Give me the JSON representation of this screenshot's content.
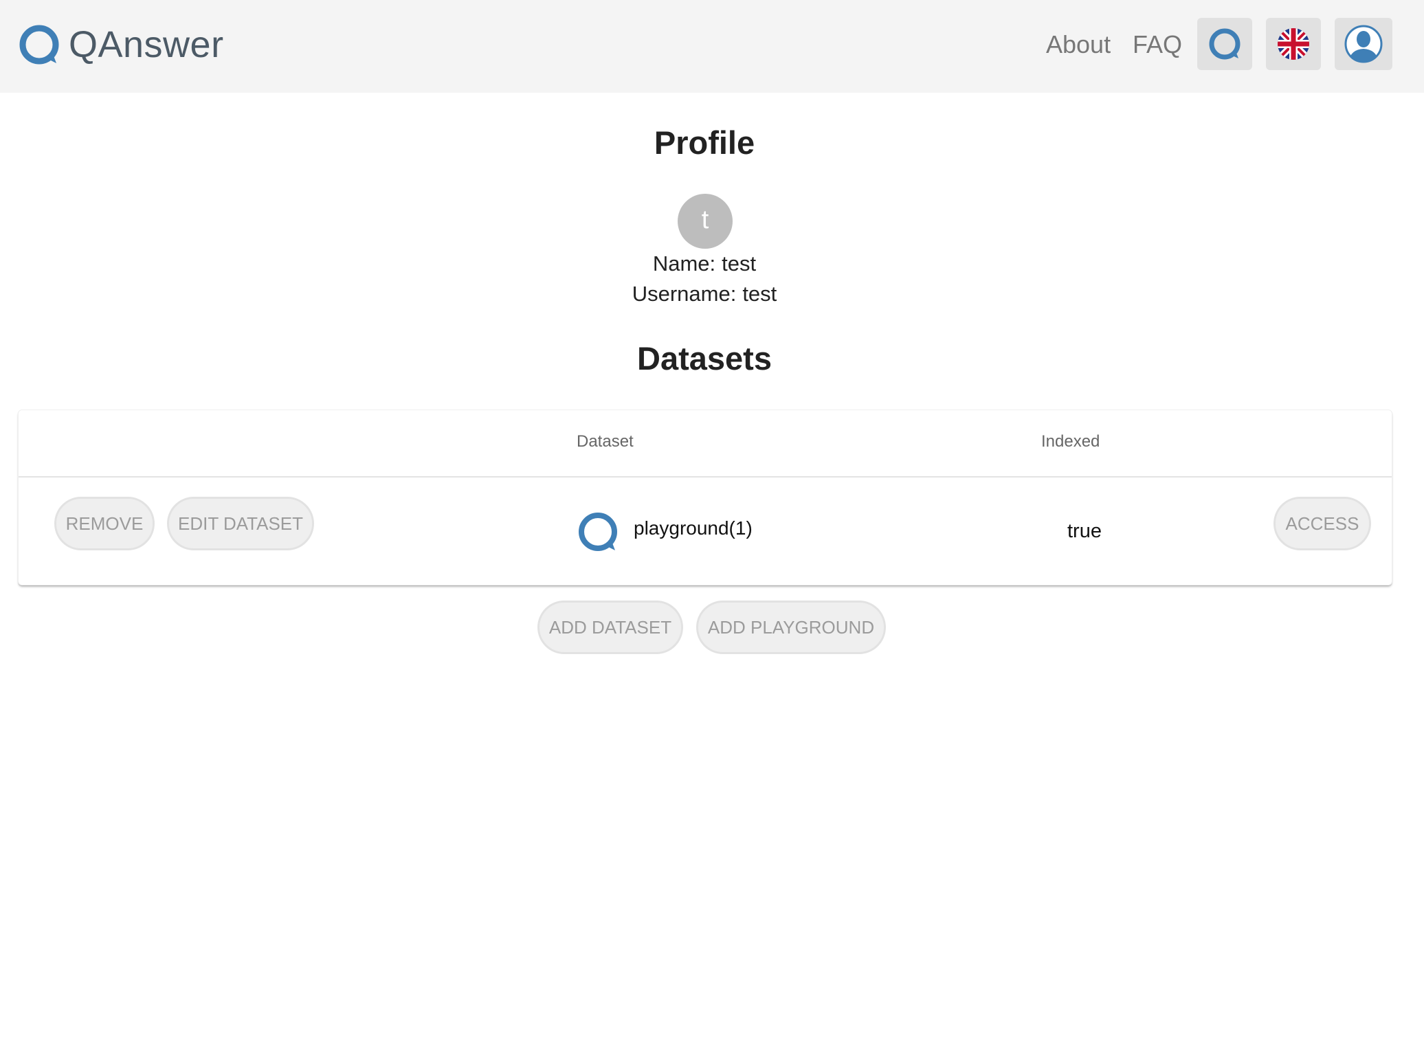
{
  "header": {
    "brand": "QAnswer",
    "nav": {
      "about": "About",
      "faq": "FAQ"
    },
    "icons": {
      "logo": "qanswer-logo-icon",
      "qanswer_button": "qanswer-icon",
      "language_button": "uk-flag-icon",
      "user_button": "user-avatar-icon"
    }
  },
  "profile": {
    "title": "Profile",
    "avatar_letter": "t",
    "name_label": "Name:",
    "name_value": "test",
    "username_label": "Username:",
    "username_value": "test"
  },
  "datasets": {
    "title": "Datasets",
    "columns": [
      "Dataset",
      "Indexed"
    ],
    "rows": [
      {
        "actions": [
          "REMOVE",
          "EDIT DATASET"
        ],
        "name": "playground(1)",
        "indexed": "true",
        "access": "ACCESS"
      }
    ],
    "add_dataset": "ADD DATASET",
    "add_playground": "ADD PLAYGROUND"
  },
  "colors": {
    "brand_blue": "#3f7fb6",
    "header_bg": "#f4f4f4",
    "button_bg": "#efefef",
    "avatar_bg": "#bdbdbd"
  }
}
